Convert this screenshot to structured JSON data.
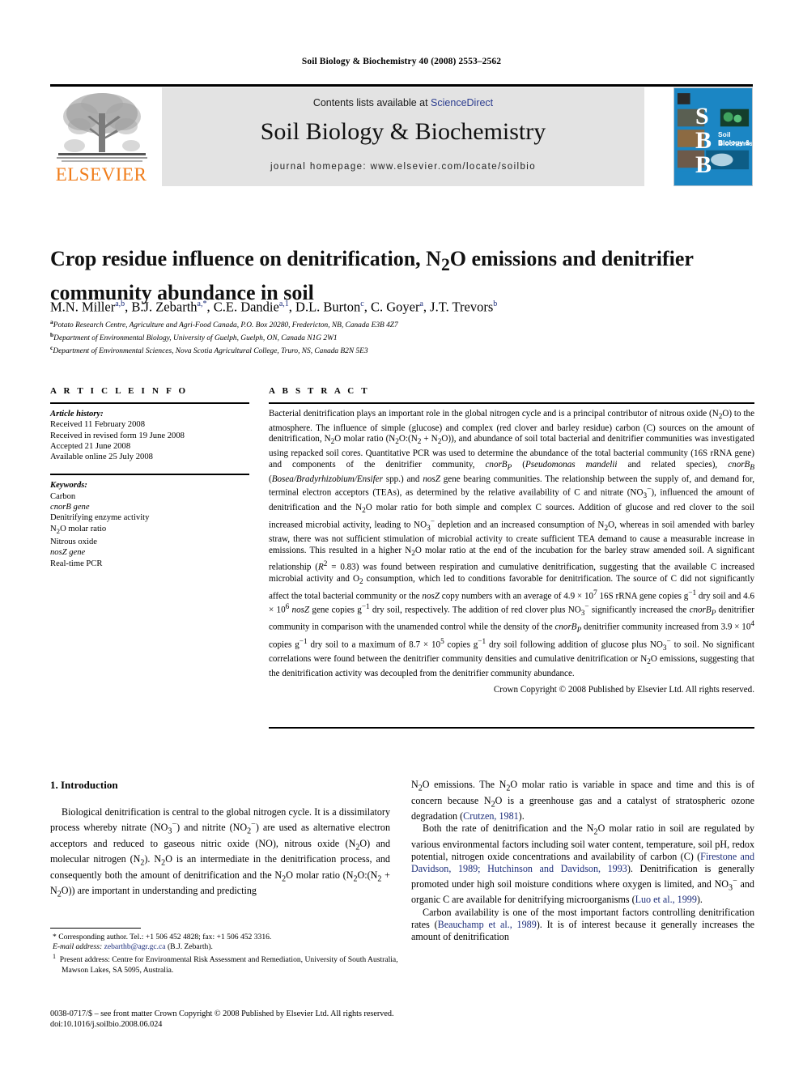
{
  "running_head": "Soil Biology & Biochemistry 40 (2008) 2553–2562",
  "banner": {
    "contents_prefix": "Contents lists available at ",
    "sciencedirect": "ScienceDirect",
    "journal_name": "Soil Biology & Biochemistry",
    "homepage": "journal homepage: www.elsevier.com/locate/soilbio",
    "publisher_wordmark": "ELSEVIER",
    "publisher_accent": "#f07d1b",
    "sciencedirect_color": "#2b3c8f",
    "band_color": "#e3e3e3",
    "cover": {
      "letters": [
        "S",
        "B",
        "B"
      ],
      "title_line1": "Soil Biology &",
      "title_line2": "Biochemistry",
      "cover_color": "#1b86c4"
    }
  },
  "article": {
    "title": "Crop residue influence on denitrification, N2O emissions and denitrifier community abundance in soil",
    "authors_html": "M.N. Miller<sup>a,b</sup>, B.J. Zebarth<sup>a,*</sup>, C.E. Dandie<sup>a,1</sup>, D.L. Burton<sup>c</sup>, C. Goyer<sup>a</sup>, J.T. Trevors<sup>b</sup>",
    "affiliations": [
      {
        "marker": "a",
        "text": "Potato Research Centre, Agriculture and Agri-Food Canada, P.O. Box 20280, Fredericton, NB, Canada E3B 4Z7"
      },
      {
        "marker": "b",
        "text": "Department of Environmental Biology, University of Guelph, Guelph, ON, Canada N1G 2W1"
      },
      {
        "marker": "c",
        "text": "Department of Environmental Sciences, Nova Scotia Agricultural College, Truro, NS, Canada B2N 5E3"
      }
    ]
  },
  "article_info": {
    "heading": "A R T I C L E   I N F O",
    "history_label": "Article history:",
    "history": [
      "Received 11 February 2008",
      "Received in revised form 19 June 2008",
      "Accepted 21 June 2008",
      "Available online 25 July 2008"
    ],
    "keywords_label": "Keywords:",
    "keywords": [
      {
        "text": "Carbon",
        "italic": false
      },
      {
        "text": "cnorB gene",
        "italic": true
      },
      {
        "text": "Denitrifying enzyme activity",
        "italic": false
      },
      {
        "text": "N2O molar ratio",
        "italic": false
      },
      {
        "text": "Nitrous oxide",
        "italic": false
      },
      {
        "text": "nosZ gene",
        "italic": true
      },
      {
        "text": "Real-time PCR",
        "italic": false
      }
    ]
  },
  "abstract": {
    "heading": "A B S T R A C T",
    "body_html": "Bacterial denitrification plays an important role in the global nitrogen cycle and is a principal contributor of nitrous oxide (N<sub>2</sub>O) to the atmosphere. The influence of simple (glucose) and complex (red clover and barley residue) carbon (C) sources on the amount of denitrification, N<sub>2</sub>O molar ratio (N<sub>2</sub>O:(N<sub>2</sub> + N<sub>2</sub>O)), and abundance of soil total bacterial and denitrifier communities was investigated using repacked soil cores. Quantitative PCR was used to determine the abundance of the total bacterial community (16S rRNA gene) and components of the denitrifier community, <i>cnorB</i><sub><i>P</i></sub> (<i>Pseudomonas mandelii</i> and related species), <i>cnorB</i><sub><i>B</i></sub> (<i>Bosea/Bradyrhizobium/Ensifer</i> spp.) and <i>nosZ</i> gene bearing communities. The relationship between the supply of, and demand for, terminal electron acceptors (TEAs), as determined by the relative availability of C and nitrate (NO<sub>3</sub><sup>&#8722;</sup>), influenced the amount of denitrification and the N<sub>2</sub>O molar ratio for both simple and complex C sources. Addition of glucose and red clover to the soil increased microbial activity, leading to NO<sub>3</sub><sup>&#8722;</sup> depletion and an increased consumption of N<sub>2</sub>O, whereas in soil amended with barley straw, there was not sufficient stimulation of microbial activity to create sufficient TEA demand to cause a measurable increase in emissions. This resulted in a higher N<sub>2</sub>O molar ratio at the end of the incubation for the barley straw amended soil. A significant relationship (<i>R</i><sup>2</sup> = 0.83) was found between respiration and cumulative denitrification, suggesting that the available C increased microbial activity and O<sub>2</sub> consumption, which led to conditions favorable for denitrification. The source of C did not significantly affect the total bacterial community or the <i>nosZ</i> copy numbers with an average of 4.9 &#215; 10<sup>7</sup> 16S rRNA gene copies g<sup>&#8722;1</sup> dry soil and 4.6 &#215; 10<sup>6</sup> <i>nosZ</i> gene copies g<sup>&#8722;1</sup> dry soil, respectively. The addition of red clover plus NO<sub>3</sub><sup>&#8722;</sup> significantly increased the <i>cnorB</i><sub><i>P</i></sub> denitrifier community in comparison with the unamended control while the density of the <i>cnorB</i><sub><i>P</i></sub> denitrifier community increased from 3.9 &#215; 10<sup>4</sup> copies g<sup>&#8722;1</sup> dry soil to a maximum of 8.7 &#215; 10<sup>5</sup> copies g<sup>&#8722;1</sup> dry soil following addition of glucose plus NO<sub>3</sub><sup>&#8722;</sup> to soil. No significant correlations were found between the denitrifier community densities and cumulative denitrification or N<sub>2</sub>O emissions, suggesting that the denitrification activity was decoupled from the denitrifier community abundance.",
    "copyright": "Crown Copyright © 2008 Published by Elsevier Ltd. All rights reserved."
  },
  "introduction": {
    "heading": "1.  Introduction",
    "left_paragraphs_html": [
      "Biological denitrification is central to the global nitrogen cycle. It is a dissimilatory process whereby nitrate (NO<sub>3</sub><sup>&#8722;</sup>) and nitrite (NO<sub>2</sub><sup>&#8722;</sup>) are used as alternative electron acceptors and reduced to gaseous nitric oxide (NO), nitrous oxide (N<sub>2</sub>O) and molecular nitrogen (N<sub>2</sub>). N<sub>2</sub>O is an intermediate in the denitrification process, and consequently both the amount of denitrification and the N<sub>2</sub>O molar ratio (N<sub>2</sub>O:(N<sub>2</sub> + N<sub>2</sub>O)) are important in understanding and predicting"
    ],
    "right_paragraphs_html": [
      "N<sub>2</sub>O emissions. The N<sub>2</sub>O molar ratio is variable in space and time and this is of concern because N<sub>2</sub>O is a greenhouse gas and a catalyst of stratospheric ozone degradation (<span class=\"cite\">Crutzen, 1981</span>).",
      "Both the rate of denitrification and the N<sub>2</sub>O molar ratio in soil are regulated by various environmental factors including soil water content, temperature, soil pH, redox potential, nitrogen oxide concentrations and availability of carbon (C) (<span class=\"cite\">Firestone and Davidson, 1989; Hutchinson and Davidson, 1993</span>). Denitrification is generally promoted under high soil moisture conditions where oxygen is limited, and NO<sub>3</sub><sup>&#8722;</sup> and organic C are available for denitrifying microorganisms (<span class=\"cite\">Luo et al., 1999</span>).",
      "Carbon availability is one of the most important factors controlling denitrification rates (<span class=\"cite\">Beauchamp et al., 1989</span>). It is of interest because it generally increases the amount of denitrification"
    ]
  },
  "footnotes": {
    "corresponding_html": "* Corresponding author. Tel.: +1 506 452 4828; fax: +1 506 452 3316.",
    "email_label": "E-mail address:",
    "email": "zebarthb@agr.gc.ca",
    "email_suffix": "(B.J. Zebarth).",
    "present_address_html": "<sup>1</sup>&nbsp; Present address: Centre for Environmental Risk Assessment and Remediation, University of South Australia, Mawson Lakes, SA 5095, Australia.",
    "issn_line": "0038-0717/$ – see front matter Crown Copyright © 2008 Published by Elsevier Ltd. All rights reserved.",
    "doi_line": "doi:10.1016/j.soilbio.2008.06.024"
  }
}
